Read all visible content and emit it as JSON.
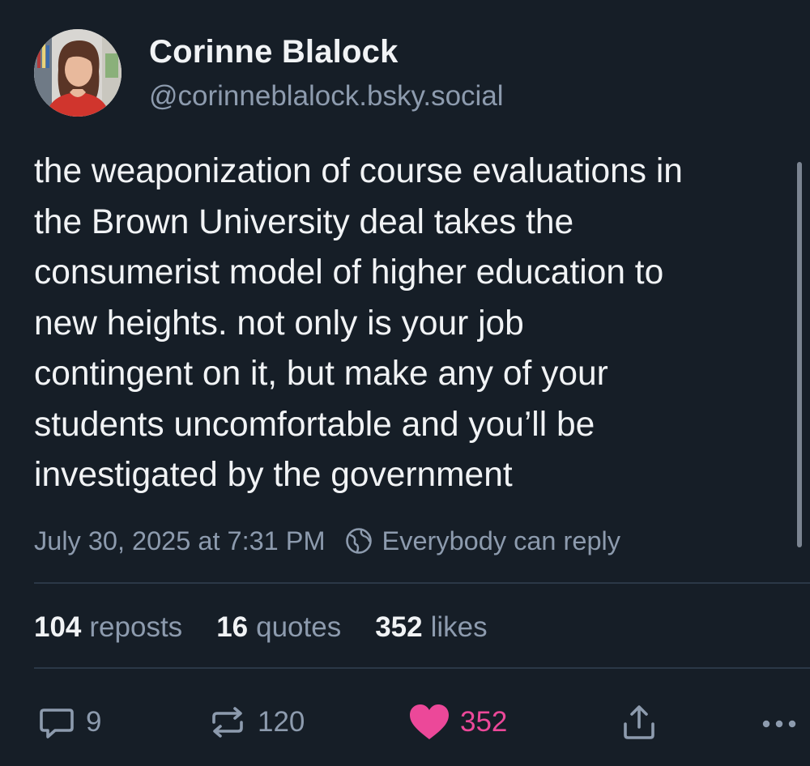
{
  "author": {
    "display_name": "Corinne Blalock",
    "handle": "@corinneblalock.bsky.social"
  },
  "post": {
    "lines": [
      "the weaponization of course evaluations in",
      "the Brown University deal takes the",
      "consumerist model of higher education to",
      "new heights. not only is your job",
      "contingent on it, but make any of your",
      "students uncomfortable and you’ll be",
      "investigated by the government"
    ],
    "timestamp": "July 30, 2025 at 7:31 PM",
    "reply_setting": "Everybody can reply"
  },
  "stats": {
    "reposts_count": "104",
    "reposts_label": "reposts",
    "quotes_count": "16",
    "quotes_label": "quotes",
    "likes_count": "352",
    "likes_label": "likes"
  },
  "actions": {
    "reply_count": "9",
    "repost_count": "120",
    "like_count": "352",
    "reply_icon": "speech-bubble-icon",
    "repost_icon": "repost-arrows-icon",
    "like_icon": "heart-icon",
    "share_icon": "share-icon",
    "more_icon": "more-dots-icon"
  },
  "colors": {
    "background": "#161e27",
    "text_primary": "#f1f3f5",
    "text_secondary": "#8d9bae",
    "divider": "#2b3847",
    "like_active": "#ec4899"
  }
}
